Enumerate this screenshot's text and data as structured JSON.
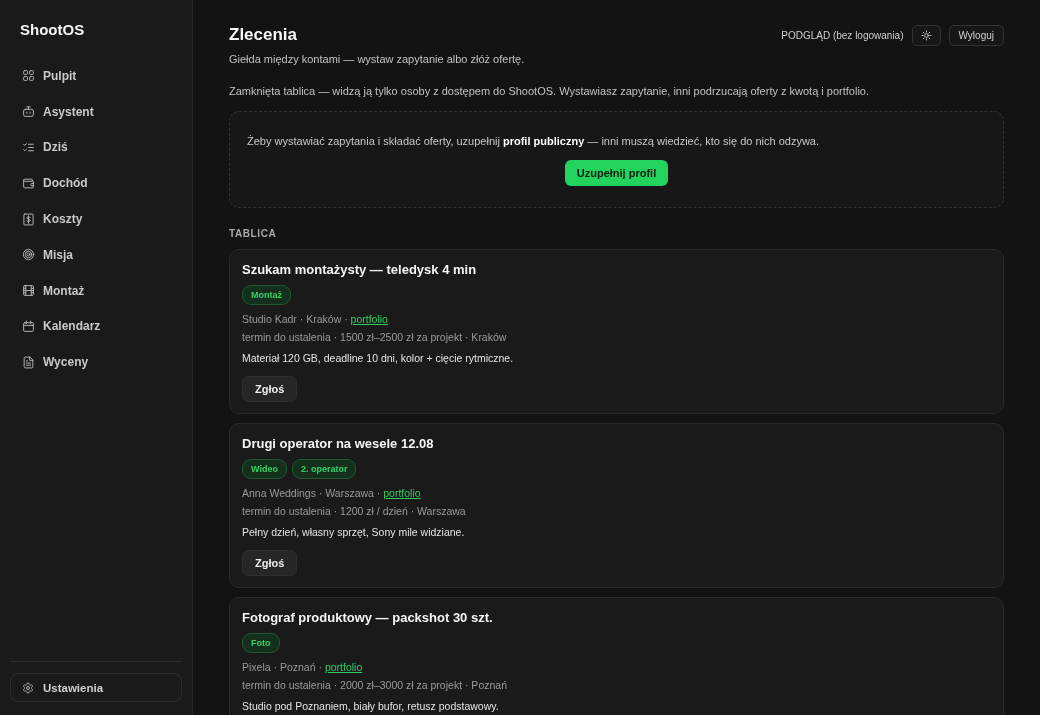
{
  "sidebar": {
    "brand": "ShootOS",
    "items": [
      {
        "label": "Pulpit",
        "selected": false
      },
      {
        "label": "Asystent",
        "selected": false
      },
      {
        "label": "Dziś",
        "selected": false
      },
      {
        "label": "Dochód",
        "selected": false
      },
      {
        "label": "Koszty",
        "selected": false
      },
      {
        "label": "Misja",
        "selected": false
      },
      {
        "label": "Montaż",
        "selected": false
      },
      {
        "label": "Kalendarz",
        "selected": false
      },
      {
        "label": "Wyceny",
        "selected": false
      }
    ],
    "settings": "Ustawienia"
  },
  "header": {
    "title": "Zlecenia",
    "mode": "PODGLĄD (bez logowania)",
    "logout": "Wyloguj"
  },
  "intro": {
    "subtitle": "Giełda między kontami — wystaw zapytanie albo złóż ofertę.",
    "description": "Zamknięta tablica — widzą ją tylko osoby z dostępem do ShootOS. Wystawiasz zapytanie, inni podrzucają oferty z kwotą i portfolio."
  },
  "notice": {
    "text": "Żeby wystawiać zapytania i składać oferty, uzupełnij **profil publiczny** — inni muszą wiedzieć, kto się do nich odzywa.",
    "button": "Uzupełnij profil"
  },
  "board": {
    "heading": "TABLICA",
    "listings": [
      {
        "title": "Szukam montażysty — teledysk 4 min",
        "tags": [
          "Montaż"
        ],
        "meta": "Studio Kadr · Kraków ·",
        "link": "portfolio",
        "terms": "termin do ustalenia · 1500 zł–2500 zł za projekt · Kraków",
        "description": "Materiał 120 GB, deadline 10 dni, kolor + cięcie rytmiczne.",
        "button": "Zgłoś"
      },
      {
        "title": "Drugi operator na wesele 12.08",
        "tags": [
          "Wideo",
          "2. operator"
        ],
        "meta": "Anna Weddings · Warszawa ·",
        "link": "portfolio",
        "terms": "termin do ustalenia · 1200 zł / dzień · Warszawa",
        "description": "Pełny dzień, własny sprzęt, Sony mile widziane.",
        "button": "Zgłoś"
      },
      {
        "title": "Fotograf produktowy — packshot 30 szt.",
        "tags": [
          "Foto"
        ],
        "meta": "Pixela · Poznań ·",
        "link": "portfolio",
        "terms": "termin do ustalenia · 2000 zł–3000 zł za projekt · Poznań",
        "description": "Studio pod Poznaniem, biały bufor, retusz podstawowy."
      }
    ]
  }
}
